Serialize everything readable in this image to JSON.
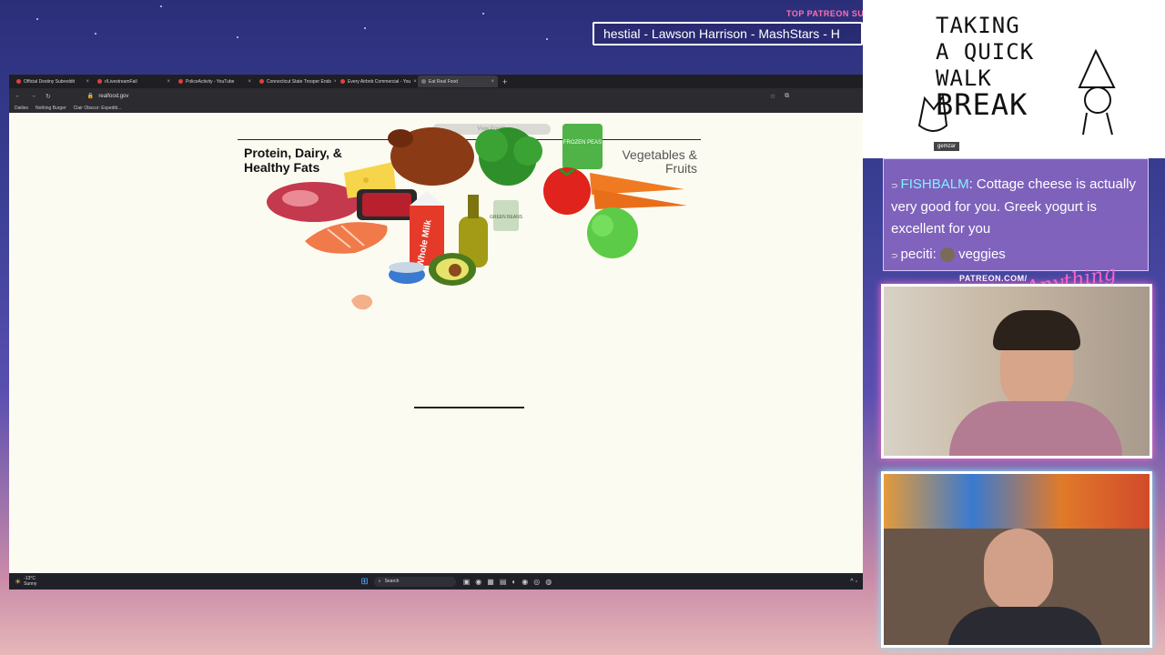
{
  "overlay": {
    "top_patreon_label": "TOP PATREON SUBS",
    "ticker": "hestial - Lawson Harrison - MashStars - H",
    "walk_break": [
      "TAKING",
      "A QUICK",
      "WALK",
      "BREAK"
    ],
    "walk_username": "gemzar",
    "patreon_url": "PATREON.COM/",
    "patreon_script": "Anything Else?"
  },
  "chat": {
    "messages": [
      {
        "user": "FISHBALM",
        "text": "Cottage cheese is actually very good for you. Greek yogurt is excellent for you"
      },
      {
        "user": "peciti",
        "text": "veggies"
      }
    ]
  },
  "browser": {
    "tabs": [
      {
        "label": "Official Destiny Subreddit"
      },
      {
        "label": "r/LivestreamFail"
      },
      {
        "label": "PoliceActivity - YouTube"
      },
      {
        "label": "Connecticut State Trooper Ends"
      },
      {
        "label": "Every Airbnb Commercial - You"
      },
      {
        "label": "Eat Real Food"
      }
    ],
    "new_tab": "+",
    "url": "realfood.gov",
    "bookmarks": [
      "Dailies",
      "Nothing Burger",
      "Clair Obscur: Expediti..."
    ],
    "taskbar": {
      "weather_temp": "-13°C",
      "weather_desc": "Sunny",
      "search_label": "Search"
    }
  },
  "page": {
    "view_label": "View Foods",
    "category_left": "Protein, Dairy, & Healthy Fats",
    "category_right": "Vegetables & Fruits",
    "milk_label": "Whole Milk",
    "peas_label": "FROZEN PEAS",
    "beans_label": "GREEN BEANS"
  },
  "colors": {
    "accent_pink": "#ff6fb0",
    "chat_name": "#7ff2ff",
    "page_bg": "#fcfbf1"
  }
}
